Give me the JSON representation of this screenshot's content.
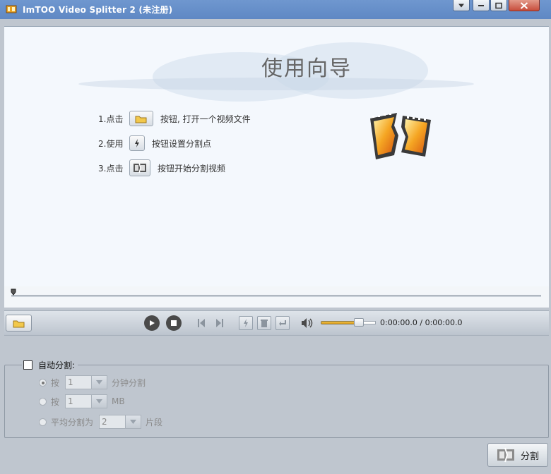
{
  "window": {
    "title": "ImTOO Video Splitter 2 (未注册)"
  },
  "guide": {
    "title": "使用向导",
    "steps": [
      {
        "num": "1.点击",
        "text": "按钮, 打开一个视频文件"
      },
      {
        "num": "2.使用",
        "text": "按钮设置分割点"
      },
      {
        "num": "3.点击",
        "text": "按钮开始分割视频"
      }
    ]
  },
  "player": {
    "time": "0:00:00.0 / 0:00:00.0",
    "volume": 0.65
  },
  "auto_split": {
    "label": "自动分割:",
    "checked": false,
    "options": [
      {
        "prefix": "按",
        "value": "1",
        "suffix": "分钟分割",
        "selected": true
      },
      {
        "prefix": "按",
        "value": "1",
        "suffix": "MB",
        "selected": false
      },
      {
        "prefix": "平均分割为",
        "value": "2",
        "suffix": "片段",
        "selected": false
      }
    ]
  },
  "split_button": "分割",
  "colors": {
    "titlebar": "#6f97cf",
    "panel": "#f4f8fd",
    "volume": "#e8b030"
  }
}
